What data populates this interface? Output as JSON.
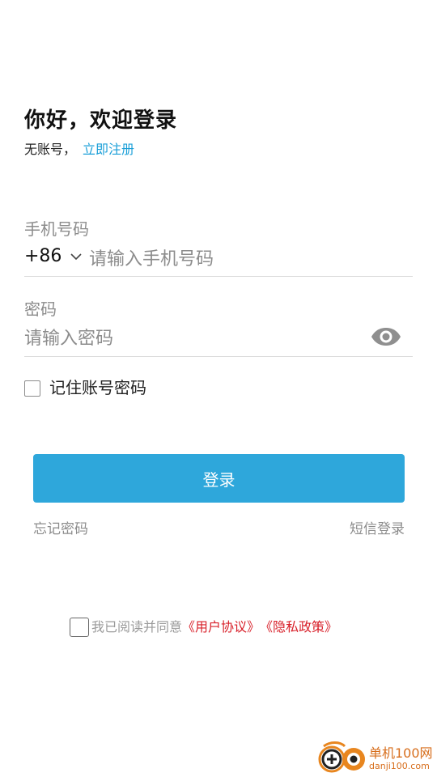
{
  "header": {
    "title": "你好，欢迎登录",
    "no_account_text": "无账号，",
    "register_link": "立即注册"
  },
  "phone_field": {
    "label": "手机号码",
    "country_code": "+86",
    "placeholder": "请输入手机号码",
    "value": ""
  },
  "password_field": {
    "label": "密码",
    "placeholder": "请输入密码",
    "value": ""
  },
  "remember": {
    "label": "记住账号密码",
    "checked": false
  },
  "login_button": "登录",
  "links": {
    "forgot_password": "忘记密码",
    "sms_login": "短信登录"
  },
  "agreement": {
    "prefix": "我已阅读并同意",
    "user_agreement": "《用户协议》",
    "privacy_policy": "《隐私政策》",
    "checked": false
  },
  "watermark": {
    "name": "单机100网",
    "url": "danji100.com"
  },
  "colors": {
    "accent": "#2ea7db",
    "link": "#1a9fd8",
    "policy_link": "#d8202a",
    "muted_text": "#8c8c8c",
    "watermark": "#d76e1c"
  },
  "icons": {
    "country_chevron": "chevron-down-icon",
    "password_visibility": "eye-icon",
    "watermark_logo": "danji-logo-icon"
  }
}
